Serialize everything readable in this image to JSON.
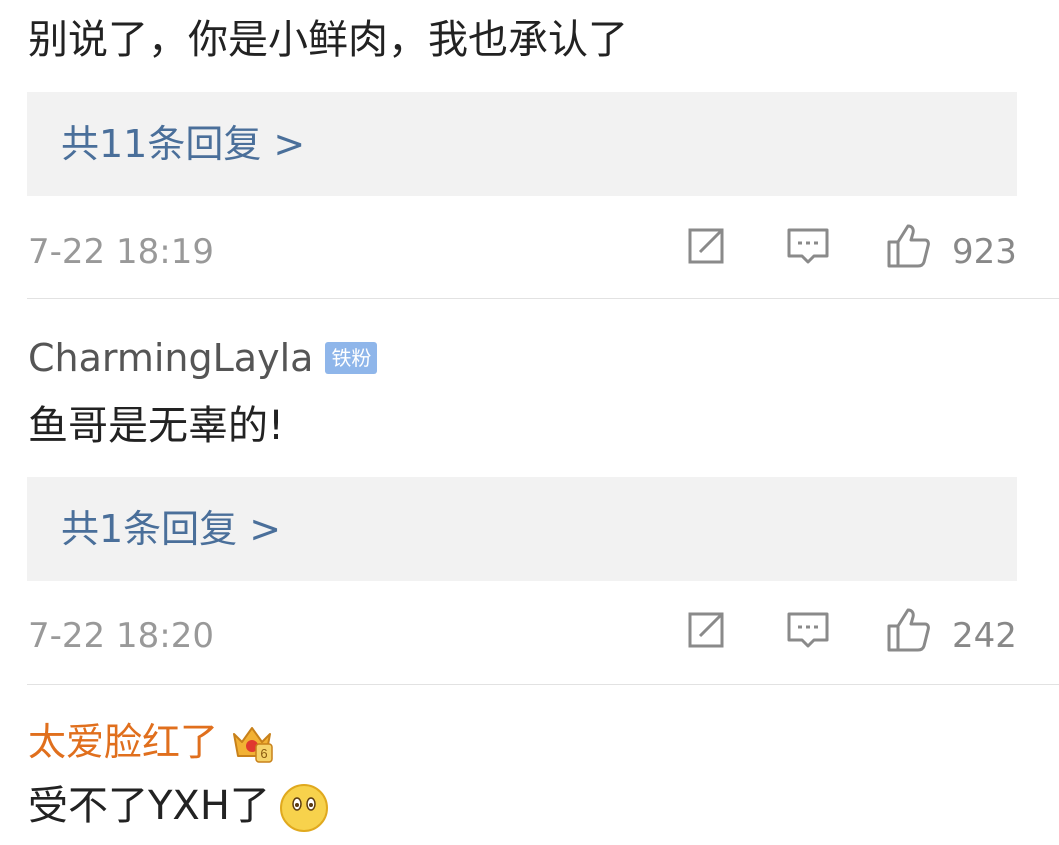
{
  "comments": [
    {
      "text": "别说了，你是小鲜肉，我也承认了",
      "reply_summary": "共11条回复 >",
      "timestamp": "7-22 18:19",
      "likes": "923"
    },
    {
      "username": "CharmingLayla",
      "badge": "铁粉",
      "text": "鱼哥是无辜的!",
      "reply_summary": "共1条回复 >",
      "timestamp": "7-22 18:20",
      "likes": "242"
    },
    {
      "username": "太爱脸红了",
      "badge_icon": "crown-level-badge-icon",
      "badge_level": "6",
      "text": "受不了YXH了",
      "emoji": "blushing-face-emoji"
    }
  ],
  "icons": {
    "repost": "repost-icon",
    "comment": "comment-icon",
    "like": "thumbs-up-icon"
  },
  "colors": {
    "link": "#4a6f9a",
    "vip_name": "#e06f1d",
    "badge_bg": "#8fb6ea",
    "reply_bg": "#f2f2f2"
  }
}
